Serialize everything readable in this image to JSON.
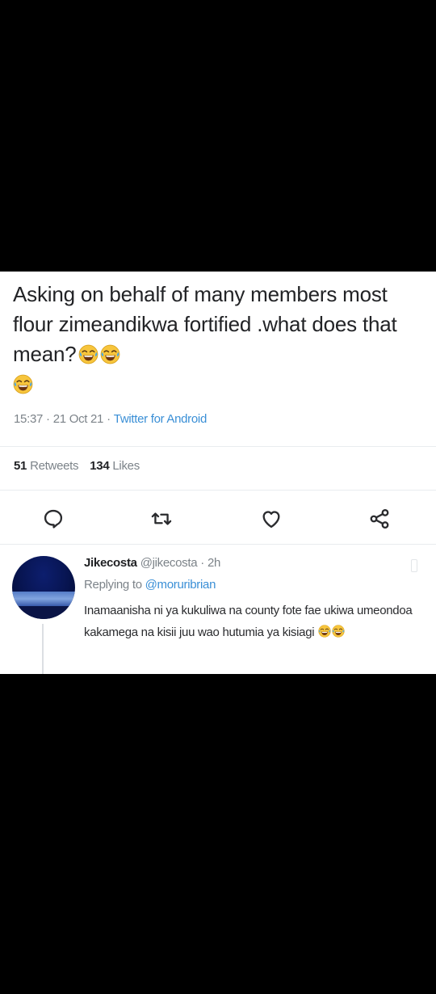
{
  "tweet": {
    "text": "Asking on behalf of many members most flour zimeandikwa fortified .what does that mean?",
    "emojis": [
      "tears-of-joy-emoji",
      "tears-of-joy-emoji",
      "tears-of-joy-emoji"
    ],
    "time": "15:37",
    "date": "21 Oct 21",
    "source": "Twitter for Android",
    "separator": "·",
    "retweets_count": "51",
    "retweets_label": "Retweets",
    "likes_count": "134",
    "likes_label": "Likes"
  },
  "actions": [
    {
      "name": "reply",
      "icon": "speech-bubble-icon"
    },
    {
      "name": "retweet",
      "icon": "retweet-icon"
    },
    {
      "name": "like",
      "icon": "heart-icon"
    },
    {
      "name": "share",
      "icon": "share-icon"
    }
  ],
  "reply": {
    "display_name": "Jikecosta",
    "handle": "@jikecosta",
    "separator": "·",
    "time_ago": "2h",
    "replying_to_label": "Replying to",
    "replying_to_handle": "@moruribrian",
    "text": "Inamaanisha ni ya kukuliwa na county fote fae ukiwa umeondoa kakamega na kisii juu wao hutumia ya kisiagi",
    "emojis": [
      "tears-of-joy-emoji",
      "tears-of-joy-emoji"
    ]
  },
  "colors": {
    "background": "#000000",
    "card": "#ffffff",
    "text_primary": "#222326",
    "text_secondary": "#7c8389",
    "link": "#3a8fd6",
    "emoji_yellow": "#f7c53c"
  }
}
